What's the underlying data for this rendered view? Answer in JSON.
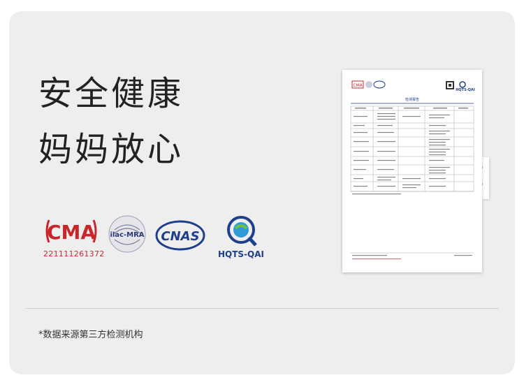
{
  "headline": {
    "line1": "安全健康",
    "line2": "妈妈放心"
  },
  "logos": {
    "cma": {
      "text": "CMA",
      "number": "221111261372",
      "color": "#c8262b"
    },
    "ilac": {
      "text": "ilac-MRA"
    },
    "cnas": {
      "text": "CNAS",
      "color": "#1e3f8a"
    },
    "hqts": {
      "text": "HQTS-QAI",
      "color": "#1e3f8a"
    }
  },
  "report": {
    "title": "检测报告",
    "header_logos": [
      "CMA",
      "ilac-MRA",
      "CNAS"
    ],
    "brand": "HQTS-QAI"
  },
  "footnote": "*数据来源第三方检测机构"
}
